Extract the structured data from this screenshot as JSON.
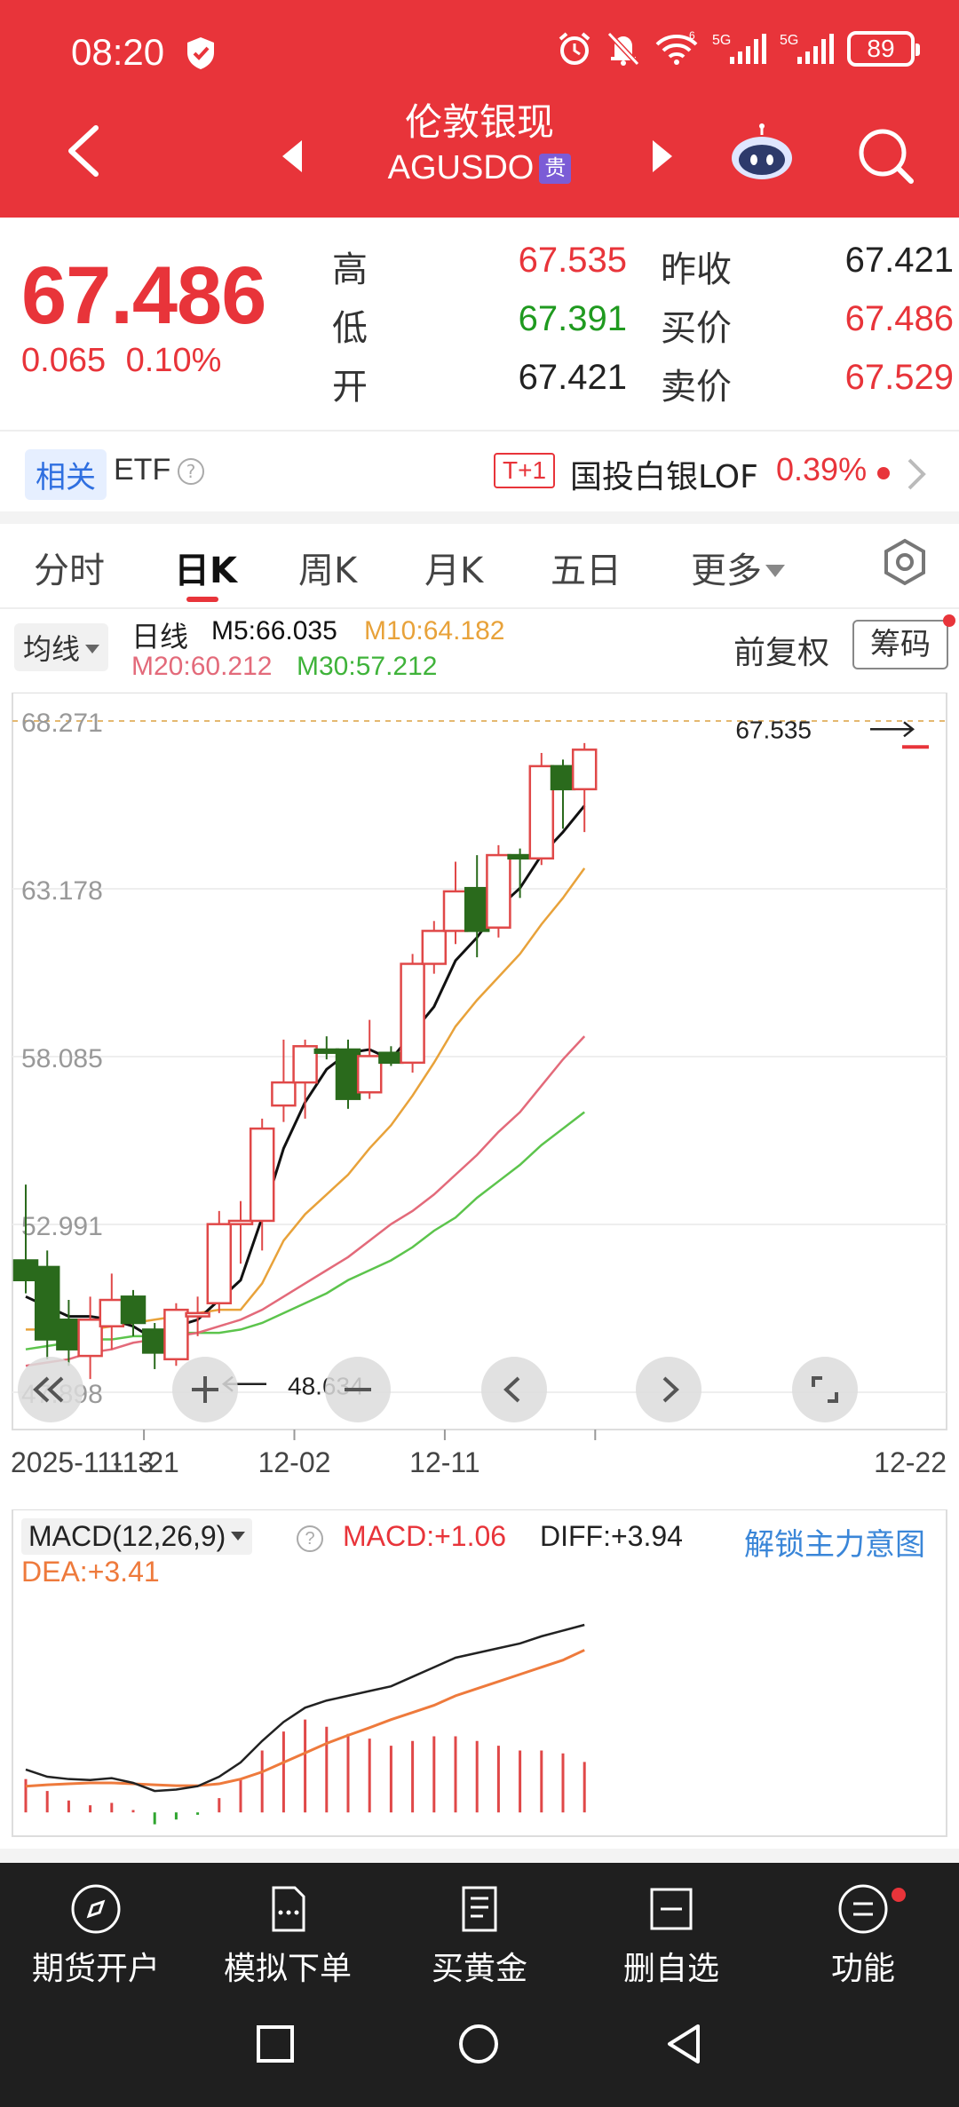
{
  "status_bar": {
    "time": "08:20",
    "battery": "89",
    "network_1": "6",
    "network_2": "5G",
    "network_3": "5G"
  },
  "header": {
    "title": "伦敦银现",
    "symbol": "AGUSDO",
    "tag": "贵"
  },
  "quote": {
    "price": "67.486",
    "change": "0.065",
    "change_pct": "0.10%",
    "stats": [
      {
        "label": "高",
        "value": "67.535",
        "color": "red"
      },
      {
        "label": "低",
        "value": "67.391",
        "color": "green"
      },
      {
        "label": "开",
        "value": "67.421",
        "color": "dark"
      },
      {
        "label": "昨收",
        "value": "67.421",
        "color": "dark"
      },
      {
        "label": "买价",
        "value": "67.486",
        "color": "red"
      },
      {
        "label": "卖价",
        "value": "67.529",
        "color": "red"
      }
    ]
  },
  "related": {
    "tag": "相关",
    "label": "ETF",
    "help": "?",
    "t1_tag": "T+1",
    "fund_name": "国投白银LOF",
    "fund_pct": "0.39%"
  },
  "tabs": [
    {
      "label": "分时",
      "active": false
    },
    {
      "label": "日K",
      "active": true
    },
    {
      "label": "周K",
      "active": false
    },
    {
      "label": "月K",
      "active": false
    },
    {
      "label": "五日",
      "active": false
    },
    {
      "label": "更多",
      "active": false
    }
  ],
  "ma_row": {
    "select_label": "均线",
    "kind": "日线",
    "m5": "M5:66.035",
    "m10": "M10:64.182",
    "m20": "M20:60.212",
    "m30": "M30:57.212",
    "adjust": "前复权",
    "chip_button": "筹码"
  },
  "colors": {
    "up": "#e04848",
    "down": "#2a6a1c",
    "m5": "#111111",
    "m10": "#e8a23a",
    "m20": "#e36a7a",
    "m30": "#5cc44c",
    "macd_diff": "#222222",
    "macd_dea": "#ee7a3c",
    "brand_red": "#e8343a"
  },
  "chart_data": [
    {
      "type": "candlestick",
      "y_ticks": [
        "68.271",
        "63.178",
        "58.085",
        "52.991",
        "47.898"
      ],
      "y_tick_values": [
        68.271,
        63.178,
        58.085,
        52.991,
        47.898
      ],
      "ylim": [
        47.898,
        68.271
      ],
      "x_ticks": [
        "2025-11-13",
        "11-21",
        "12-02",
        "12-11",
        "12-22"
      ],
      "x_tick_index": [
        0,
        6,
        13,
        20,
        27
      ],
      "high_marker": "67.535",
      "low_marker": "48.634",
      "candles": [
        {
          "o": 51.9,
          "h": 54.2,
          "l": 50.9,
          "c": 51.3
        },
        {
          "o": 51.7,
          "h": 52.2,
          "l": 48.9,
          "c": 49.5
        },
        {
          "o": 50.1,
          "h": 50.7,
          "l": 48.7,
          "c": 49.2
        },
        {
          "o": 49.0,
          "h": 50.8,
          "l": 48.3,
          "c": 50.1
        },
        {
          "o": 49.9,
          "h": 51.5,
          "l": 49.2,
          "c": 50.7
        },
        {
          "o": 50.8,
          "h": 51.0,
          "l": 49.6,
          "c": 50.0
        },
        {
          "o": 49.8,
          "h": 50.0,
          "l": 48.6,
          "c": 49.1
        },
        {
          "o": 48.9,
          "h": 50.6,
          "l": 48.7,
          "c": 50.4
        },
        {
          "o": 50.2,
          "h": 50.8,
          "l": 49.6,
          "c": 50.3
        },
        {
          "o": 50.6,
          "h": 53.4,
          "l": 50.3,
          "c": 53.0
        },
        {
          "o": 53.0,
          "h": 53.7,
          "l": 51.8,
          "c": 53.1
        },
        {
          "o": 53.1,
          "h": 56.2,
          "l": 52.2,
          "c": 55.9
        },
        {
          "o": 56.6,
          "h": 58.6,
          "l": 56.1,
          "c": 57.3
        },
        {
          "o": 57.3,
          "h": 58.6,
          "l": 56.2,
          "c": 58.4
        },
        {
          "o": 58.3,
          "h": 58.7,
          "l": 58.0,
          "c": 58.2
        },
        {
          "o": 58.3,
          "h": 58.6,
          "l": 56.5,
          "c": 56.8
        },
        {
          "o": 57.0,
          "h": 59.2,
          "l": 56.8,
          "c": 58.1
        },
        {
          "o": 58.2,
          "h": 58.4,
          "l": 57.8,
          "c": 57.9
        },
        {
          "o": 57.9,
          "h": 61.2,
          "l": 57.6,
          "c": 60.9
        },
        {
          "o": 60.9,
          "h": 62.2,
          "l": 60.6,
          "c": 61.9
        },
        {
          "o": 61.9,
          "h": 64.0,
          "l": 61.5,
          "c": 63.1
        },
        {
          "o": 63.2,
          "h": 64.2,
          "l": 61.1,
          "c": 61.9
        },
        {
          "o": 62.0,
          "h": 64.5,
          "l": 61.7,
          "c": 64.2
        },
        {
          "o": 64.2,
          "h": 64.4,
          "l": 62.9,
          "c": 64.1
        },
        {
          "o": 64.1,
          "h": 67.3,
          "l": 63.9,
          "c": 66.9
        },
        {
          "o": 66.9,
          "h": 67.1,
          "l": 65.0,
          "c": 66.2
        },
        {
          "o": 66.2,
          "h": 67.6,
          "l": 64.9,
          "c": 67.4
        }
      ],
      "ma": {
        "m5": [
          50.8,
          50.5,
          50.2,
          50.2,
          50.1,
          49.9,
          49.5,
          49.9,
          50.1,
          50.7,
          51.3,
          53.2,
          55.3,
          56.7,
          57.7,
          58.2,
          58.3,
          58.0,
          58.8,
          59.6,
          61.0,
          61.7,
          62.6,
          63.2,
          64.2,
          64.9,
          65.7
        ],
        "m10": [
          49.8,
          49.8,
          49.8,
          49.8,
          49.9,
          50.0,
          50.1,
          50.2,
          50.3,
          50.4,
          50.4,
          51.2,
          52.5,
          53.3,
          53.9,
          54.5,
          55.3,
          56.0,
          56.9,
          57.9,
          59.0,
          59.8,
          60.5,
          61.2,
          62.1,
          62.9,
          63.8
        ],
        "m20": [
          48.7,
          48.8,
          48.9,
          49.1,
          49.2,
          49.4,
          49.5,
          49.6,
          49.7,
          49.9,
          50.1,
          50.4,
          50.8,
          51.2,
          51.6,
          52.0,
          52.5,
          53.0,
          53.4,
          53.9,
          54.5,
          55.1,
          55.8,
          56.4,
          57.2,
          58.0,
          58.7
        ],
        "m30": [
          49.2,
          49.3,
          49.4,
          49.5,
          49.5,
          49.6,
          49.6,
          49.7,
          49.7,
          49.7,
          49.8,
          50.0,
          50.3,
          50.6,
          50.9,
          51.3,
          51.6,
          51.9,
          52.3,
          52.8,
          53.2,
          53.8,
          54.3,
          54.8,
          55.4,
          55.9,
          56.4
        ]
      }
    },
    {
      "type": "macd",
      "title": "MACD(12,26,9)",
      "macd_label": "MACD:+1.06",
      "diff_label": "DIFF:+3.94",
      "dea_label": "DEA:+3.41",
      "ylim": [
        -0.5,
        4.5
      ],
      "diff": [
        0.9,
        0.75,
        0.7,
        0.68,
        0.72,
        0.62,
        0.45,
        0.48,
        0.55,
        0.75,
        1.05,
        1.5,
        1.9,
        2.2,
        2.35,
        2.45,
        2.55,
        2.65,
        2.85,
        3.05,
        3.25,
        3.35,
        3.45,
        3.55,
        3.7,
        3.82,
        3.94
      ],
      "dea": [
        0.55,
        0.58,
        0.6,
        0.62,
        0.62,
        0.6,
        0.58,
        0.56,
        0.56,
        0.6,
        0.7,
        0.85,
        1.05,
        1.25,
        1.45,
        1.62,
        1.78,
        1.95,
        2.1,
        2.25,
        2.45,
        2.6,
        2.75,
        2.9,
        3.05,
        3.2,
        3.41
      ],
      "hist": [
        0.7,
        0.45,
        0.25,
        0.15,
        0.2,
        0.05,
        -0.25,
        -0.15,
        -0.05,
        0.3,
        0.7,
        1.3,
        1.7,
        1.95,
        1.8,
        1.65,
        1.55,
        1.4,
        1.5,
        1.6,
        1.6,
        1.5,
        1.4,
        1.3,
        1.3,
        1.24,
        1.06
      ]
    }
  ],
  "macd_extra": {
    "unlock": "解锁主力意图",
    "help": "?"
  },
  "bottom_nav": [
    {
      "label": "期货开户",
      "icon": "compass-icon"
    },
    {
      "label": "模拟下单",
      "icon": "simulate-order-icon"
    },
    {
      "label": "买黄金",
      "icon": "document-icon"
    },
    {
      "label": "删自选",
      "icon": "remove-watchlist-icon"
    },
    {
      "label": "功能",
      "icon": "menu-icon"
    }
  ]
}
